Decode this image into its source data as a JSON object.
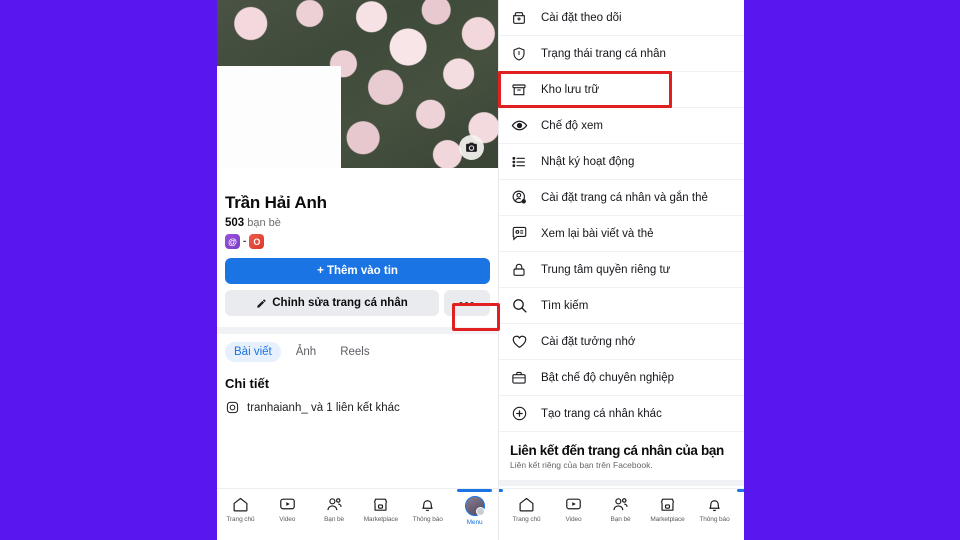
{
  "background_color": "#5a16ee",
  "accent_blue": "#1b74e4",
  "highlight_red": "#e02020",
  "left_phone": {
    "cover": {
      "camera_icon": "camera-icon"
    },
    "profile": {
      "name": "Trần Hải Anh",
      "friend_count": "503",
      "friend_label": "bạn bè",
      "badge_one": "@",
      "badge_separator": "-",
      "badge_two": "O"
    },
    "buttons": {
      "add_to_story": "+ Thêm vào tin",
      "edit_profile": "Chỉnh sửa trang cá nhân",
      "more": "•••"
    },
    "tabs": [
      {
        "label": "Bài viết",
        "active": true
      },
      {
        "label": "Ảnh",
        "active": false
      },
      {
        "label": "Reels",
        "active": false
      }
    ],
    "details_title": "Chi tiết",
    "details_rows": [
      {
        "icon": "instagram-icon",
        "text": "tranhaianh_ và 1 liên kết khác"
      }
    ],
    "bottom_nav": [
      {
        "label": "Trang chủ",
        "icon": "home-icon",
        "active": false
      },
      {
        "label": "Video",
        "icon": "video-icon",
        "active": false
      },
      {
        "label": "Bạn bè",
        "icon": "friends-icon",
        "active": false
      },
      {
        "label": "Marketplace",
        "icon": "marketplace-icon",
        "active": false
      },
      {
        "label": "Thông báo",
        "icon": "bell-icon",
        "active": false
      },
      {
        "label": "Menu",
        "icon": "avatar-icon",
        "active": true
      }
    ]
  },
  "right_phone": {
    "menu_items": [
      {
        "label": "Cài đặt theo dõi",
        "icon": "add-box-icon",
        "highlighted": false
      },
      {
        "label": "Trạng thái trang cá nhân",
        "icon": "shield-icon",
        "highlighted": false
      },
      {
        "label": "Kho lưu trữ",
        "icon": "archive-icon",
        "highlighted": true
      },
      {
        "label": "Chế độ xem",
        "icon": "eye-icon",
        "highlighted": false
      },
      {
        "label": "Nhật ký hoạt động",
        "icon": "list-icon",
        "highlighted": false
      },
      {
        "label": "Cài đặt trang cá nhân và gắn thẻ",
        "icon": "person-gear-icon",
        "highlighted": false
      },
      {
        "label": "Xem lại bài viết và thẻ",
        "icon": "chat-tag-icon",
        "highlighted": false
      },
      {
        "label": "Trung tâm quyền riêng tư",
        "icon": "lock-icon",
        "highlighted": false
      },
      {
        "label": "Tìm kiếm",
        "icon": "search-icon",
        "highlighted": false
      },
      {
        "label": "Cài đặt tưởng nhớ",
        "icon": "heart-icon",
        "highlighted": false
      },
      {
        "label": "Bật chế độ chuyên nghiệp",
        "icon": "briefcase-icon",
        "highlighted": false
      },
      {
        "label": "Tạo trang cá nhân khác",
        "icon": "plus-circle-icon",
        "highlighted": false
      }
    ],
    "link_section": {
      "title": "Liên kết đến trang cá nhân của bạn",
      "subtitle": "Liên kết riêng của bạn trên Facebook."
    },
    "bottom_nav": [
      {
        "label": "Trang chủ",
        "icon": "home-icon"
      },
      {
        "label": "Video",
        "icon": "video-icon"
      },
      {
        "label": "Bạn bè",
        "icon": "friends-icon"
      },
      {
        "label": "Marketplace",
        "icon": "marketplace-icon"
      },
      {
        "label": "Thông báo",
        "icon": "bell-icon"
      }
    ]
  }
}
